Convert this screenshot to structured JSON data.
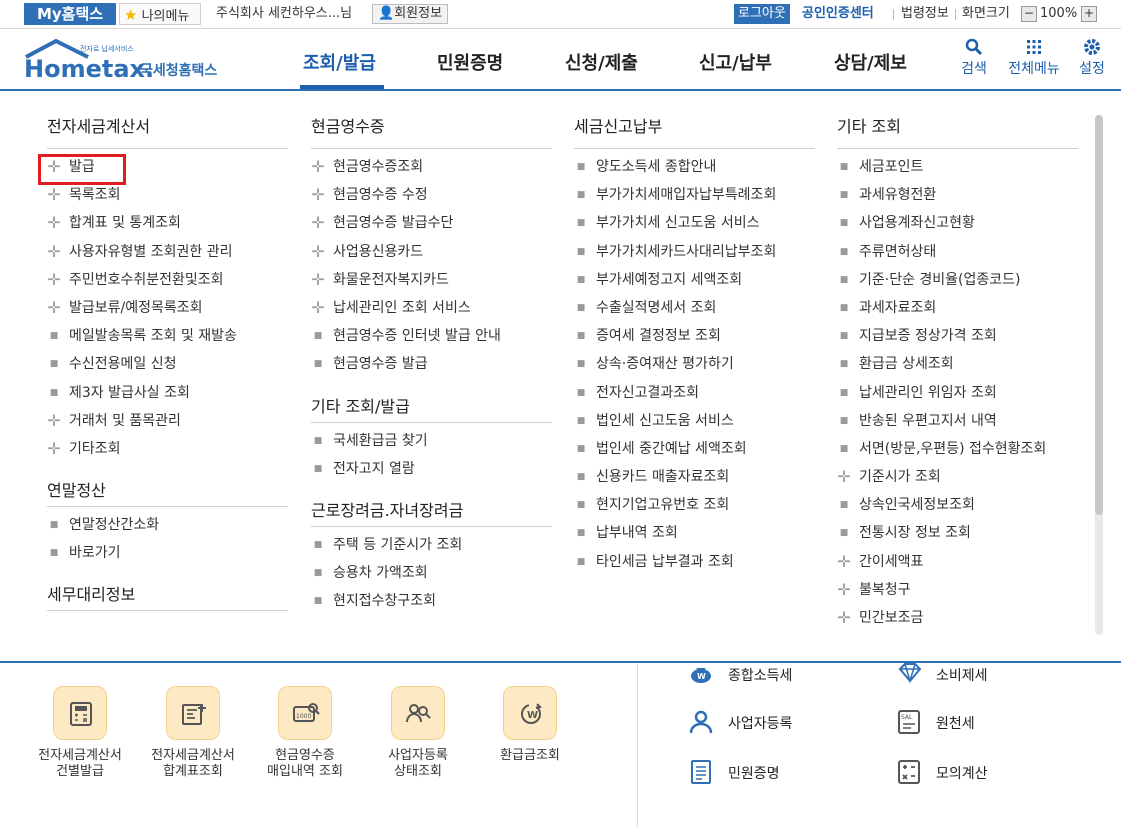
{
  "topbar": {
    "myhome": "My홈택스",
    "mymenu": "나의메뉴",
    "company": "주식회사 세컨하우스...님",
    "member_info": "회원정보",
    "logout": "로그아웃",
    "cert_center": "공인인증센터",
    "law_info": "법령정보",
    "screen_size": "화면크기",
    "zoom_minus": "−",
    "zoom_value": "100%",
    "zoom_plus": "+"
  },
  "logo": {
    "tagline": "전자로 납세서비스",
    "brand": "Hometax.",
    "name": "국세청홈택스"
  },
  "nav": {
    "items": [
      "조회/발급",
      "민원증명",
      "신청/제출",
      "신고/납부",
      "상담/제보"
    ],
    "active_index": 0
  },
  "header_icons": {
    "search": "검색",
    "all_menu": "전체메뉴",
    "settings": "설정"
  },
  "columns": [
    {
      "sections": [
        {
          "title": "전자세금계산서",
          "items": [
            {
              "label": "발급",
              "marker": "plus"
            },
            {
              "label": "목록조회",
              "marker": "plus"
            },
            {
              "label": "합계표 및 통계조회",
              "marker": "plus"
            },
            {
              "label": "사용자유형별 조회권한 관리",
              "marker": "plus"
            },
            {
              "label": "주민번호수취분전환및조회",
              "marker": "plus"
            },
            {
              "label": "발급보류/예정목록조회",
              "marker": "plus"
            },
            {
              "label": "메일발송목록 조회 및 재발송",
              "marker": "dot"
            },
            {
              "label": "수신전용메일 신청",
              "marker": "dot"
            },
            {
              "label": "제3자 발급사실 조회",
              "marker": "dot"
            },
            {
              "label": "거래처 및 품목관리",
              "marker": "plus"
            },
            {
              "label": "기타조회",
              "marker": "plus"
            }
          ]
        },
        {
          "title": "연말정산",
          "items": [
            {
              "label": "연말정산간소화",
              "marker": "dot"
            },
            {
              "label": "바로가기",
              "marker": "dot"
            }
          ]
        },
        {
          "title": "세무대리정보",
          "items": []
        }
      ]
    },
    {
      "sections": [
        {
          "title": "현금영수증",
          "items": [
            {
              "label": "현금영수증조회",
              "marker": "plus"
            },
            {
              "label": "현금영수증 수정",
              "marker": "plus"
            },
            {
              "label": "현금영수증 발급수단",
              "marker": "plus"
            },
            {
              "label": "사업용신용카드",
              "marker": "plus"
            },
            {
              "label": "화물운전자복지카드",
              "marker": "plus"
            },
            {
              "label": "납세관리인 조회 서비스",
              "marker": "plus"
            },
            {
              "label": "현금영수증 인터넷 발급 안내",
              "marker": "dot"
            },
            {
              "label": "현금영수증 발급",
              "marker": "dot"
            }
          ]
        },
        {
          "title": "기타 조회/발급",
          "items": [
            {
              "label": "국세환급금 찾기",
              "marker": "dot"
            },
            {
              "label": "전자고지 열람",
              "marker": "dot"
            }
          ]
        },
        {
          "title": "근로장려금.자녀장려금",
          "items": [
            {
              "label": "주택 등 기준시가 조회",
              "marker": "dot"
            },
            {
              "label": "승용차 가액조회",
              "marker": "dot"
            },
            {
              "label": "현지접수창구조회",
              "marker": "dot"
            }
          ]
        }
      ]
    },
    {
      "sections": [
        {
          "title": "세금신고납부",
          "items": [
            {
              "label": "양도소득세 종합안내",
              "marker": "dot"
            },
            {
              "label": "부가가치세매입자납부특례조회",
              "marker": "dot"
            },
            {
              "label": "부가가치세 신고도움 서비스",
              "marker": "dot"
            },
            {
              "label": "부가가치세카드사대리납부조회",
              "marker": "dot"
            },
            {
              "label": "부가세예정고지 세액조회",
              "marker": "dot"
            },
            {
              "label": "수출실적명세서 조회",
              "marker": "dot"
            },
            {
              "label": "증여세 결정정보 조회",
              "marker": "dot"
            },
            {
              "label": "상속·증여재산 평가하기",
              "marker": "dot"
            },
            {
              "label": "전자신고결과조회",
              "marker": "dot"
            },
            {
              "label": "법인세 신고도움 서비스",
              "marker": "dot"
            },
            {
              "label": "법인세 중간예납 세액조회",
              "marker": "dot"
            },
            {
              "label": "신용카드 매출자료조회",
              "marker": "dot"
            },
            {
              "label": "현지기업고유번호 조회",
              "marker": "dot"
            },
            {
              "label": "납부내역 조회",
              "marker": "dot"
            },
            {
              "label": "타인세금 납부결과 조회",
              "marker": "dot"
            }
          ]
        }
      ]
    },
    {
      "sections": [
        {
          "title": "기타 조회",
          "items": [
            {
              "label": "세금포인트",
              "marker": "dot"
            },
            {
              "label": "과세유형전환",
              "marker": "dot"
            },
            {
              "label": "사업용계좌신고현황",
              "marker": "dot"
            },
            {
              "label": "주류면허상태",
              "marker": "dot"
            },
            {
              "label": "기준·단순 경비율(업종코드)",
              "marker": "dot"
            },
            {
              "label": "과세자료조회",
              "marker": "dot"
            },
            {
              "label": "지급보증 정상가격 조회",
              "marker": "dot"
            },
            {
              "label": "환급금 상세조회",
              "marker": "dot"
            },
            {
              "label": "납세관리인 위임자 조회",
              "marker": "dot"
            },
            {
              "label": "반송된 우편고지서 내역",
              "marker": "dot"
            },
            {
              "label": "서면(방문,우편등) 접수현황조회",
              "marker": "dot"
            },
            {
              "label": "기준시가 조회",
              "marker": "plus"
            },
            {
              "label": "상속인국세정보조회",
              "marker": "dot"
            },
            {
              "label": "전통시장 정보 조회",
              "marker": "dot"
            },
            {
              "label": "간이세액표",
              "marker": "plus"
            },
            {
              "label": "불복청구",
              "marker": "plus"
            },
            {
              "label": "민간보조금",
              "marker": "plus"
            }
          ]
        }
      ]
    }
  ],
  "quick_links": [
    {
      "line1": "전자세금계산서",
      "line2": "건별발급",
      "icon": "calculator-icon"
    },
    {
      "line1": "전자세금계산서",
      "line2": "합계표조회",
      "icon": "invoice-add-icon"
    },
    {
      "line1": "현금영수증",
      "line2": "매입내역 조회",
      "icon": "receipt-search-icon"
    },
    {
      "line1": "사업자등록",
      "line2": "상태조회",
      "icon": "people-search-icon"
    },
    {
      "line1": "환급금조회",
      "line2": "",
      "icon": "refund-icon"
    }
  ],
  "right_links": [
    {
      "label": "종합소득세",
      "icon": "money-bag-icon"
    },
    {
      "label": "소비제세",
      "icon": "diamond-icon"
    },
    {
      "label": "사업자등록",
      "icon": "person-icon"
    },
    {
      "label": "원천세",
      "icon": "salary-icon"
    },
    {
      "label": "민원증명",
      "icon": "document-icon"
    },
    {
      "label": "모의계산",
      "icon": "calculator-icon"
    }
  ],
  "colors": {
    "primary": "#2f6fb6",
    "highlight": "#e11b22",
    "quick_bg": "#fde9c3"
  }
}
